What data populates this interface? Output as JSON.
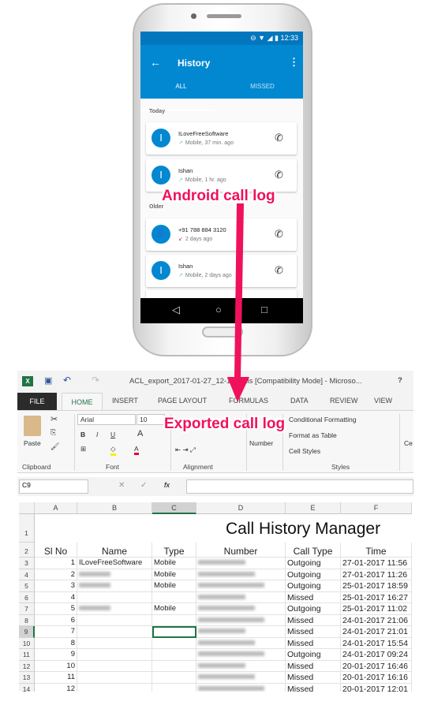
{
  "android": {
    "status_time": "12:33",
    "title": "History",
    "tabs": [
      "ALL",
      "MISSED"
    ],
    "sections": {
      "today": "Today",
      "older": "Older"
    },
    "calls": [
      {
        "avatar": "I",
        "name": "ILoveFreeSoftware",
        "meta": "Mobile, 37 min. ago",
        "direction": "outgoing"
      },
      {
        "avatar": "I",
        "name": "Ishan",
        "meta": "Mobile, 1 hr. ago",
        "direction": "outgoing"
      },
      {
        "avatar": "person-icon",
        "name": "+91 788 884 3120",
        "meta": "2 days ago",
        "direction": "missed"
      },
      {
        "avatar": "I",
        "name": "Ishan",
        "meta": "Mobile, 2 days ago",
        "direction": "outgoing"
      }
    ]
  },
  "annotations": {
    "android": "Android call log",
    "excel": "Exported call log",
    "color": "#f0115c"
  },
  "excel": {
    "window_title": "ACL_export_2017-01-27_12-15-0.xls  [Compatibility Mode] - Microso...",
    "help": "?",
    "tabs": [
      "FILE",
      "HOME",
      "INSERT",
      "PAGE LAYOUT",
      "FORMULAS",
      "DATA",
      "REVIEW",
      "VIEW"
    ],
    "ribbon": {
      "paste": "Paste",
      "font_name": "Arial",
      "font_size": "10",
      "number": "Number",
      "conditional_formatting": "Conditional Formatting",
      "format_as_table": "Format as Table",
      "cell_styles": "Cell Styles",
      "groups": [
        "Clipboard",
        "Font",
        "Alignment",
        "Styles"
      ],
      "cells_partial": "Ce"
    },
    "name_box": "C9",
    "fx": "fx",
    "columns": [
      "A",
      "B",
      "C",
      "D",
      "E",
      "F"
    ],
    "sheet_title": "Call History Manager",
    "headers": [
      "Sl No",
      "Name",
      "Type",
      "Number",
      "Call Type",
      "Time"
    ],
    "rows": [
      {
        "row": "3",
        "sl": "1",
        "name": "ILoveFreeSoftware",
        "type": "Mobile",
        "call_type": "Outgoing",
        "time": "27-01-2017 11:56"
      },
      {
        "row": "4",
        "sl": "2",
        "name": "",
        "type": "Mobile",
        "call_type": "Outgoing",
        "time": "27-01-2017 11:26"
      },
      {
        "row": "5",
        "sl": "3",
        "name": "",
        "type": "Mobile",
        "call_type": "Outgoing",
        "time": "25-01-2017 18:59"
      },
      {
        "row": "6",
        "sl": "4",
        "name": "",
        "type": "",
        "call_type": "Missed",
        "time": "25-01-2017 16:27"
      },
      {
        "row": "7",
        "sl": "5",
        "name": "",
        "type": "Mobile",
        "call_type": "Outgoing",
        "time": "25-01-2017 11:02"
      },
      {
        "row": "8",
        "sl": "6",
        "name": "",
        "type": "",
        "call_type": "Missed",
        "time": "24-01-2017 21:06"
      },
      {
        "row": "9",
        "sl": "7",
        "name": "",
        "type": "",
        "call_type": "Missed",
        "time": "24-01-2017 21:01"
      },
      {
        "row": "10",
        "sl": "8",
        "name": "",
        "type": "",
        "call_type": "Missed",
        "time": "24-01-2017 15:54"
      },
      {
        "row": "11",
        "sl": "9",
        "name": "",
        "type": "",
        "call_type": "Outgoing",
        "time": "24-01-2017 09:24"
      },
      {
        "row": "12",
        "sl": "10",
        "name": "",
        "type": "",
        "call_type": "Missed",
        "time": "20-01-2017 16:46"
      },
      {
        "row": "13",
        "sl": "11",
        "name": "",
        "type": "",
        "call_type": "Missed",
        "time": "20-01-2017 16:16"
      },
      {
        "row": "14",
        "sl": "12",
        "name": "",
        "type": "",
        "call_type": "Missed",
        "time": "20-01-2017 12:01"
      }
    ]
  }
}
